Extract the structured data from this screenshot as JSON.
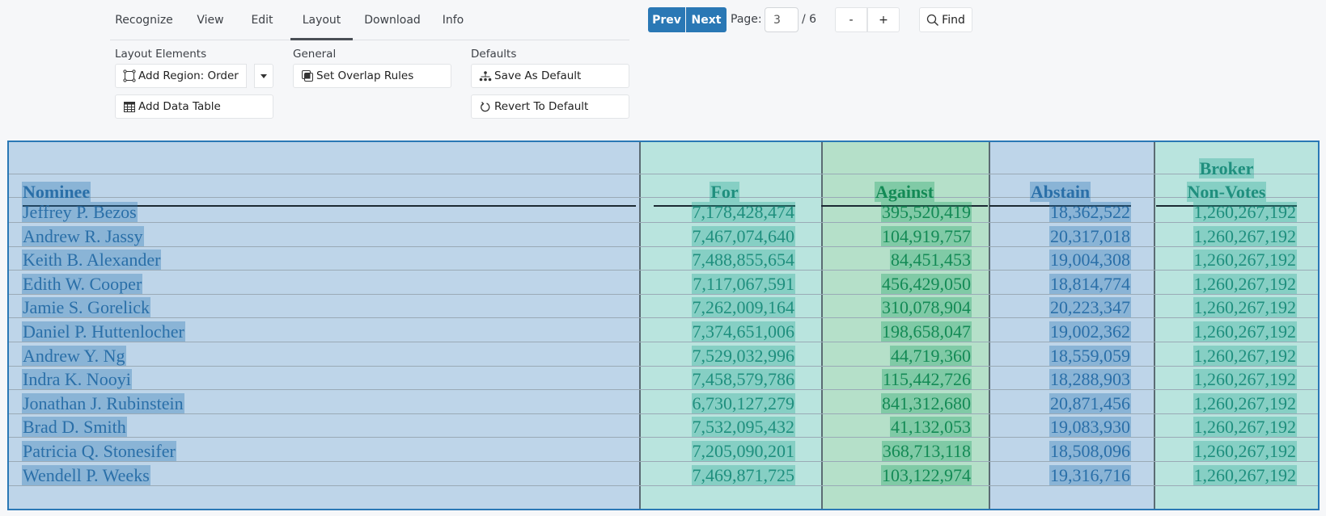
{
  "tabs": [
    {
      "label": "Recognize",
      "active": false
    },
    {
      "label": "View",
      "active": false
    },
    {
      "label": "Edit",
      "active": false
    },
    {
      "label": "Layout",
      "active": true
    },
    {
      "label": "Download",
      "active": false
    },
    {
      "label": "Info",
      "active": false
    }
  ],
  "groups": {
    "layout_elements": {
      "label": "Layout Elements",
      "add_region": "Add Region: Order",
      "add_data_table": "Add Data Table"
    },
    "general": {
      "label": "General",
      "set_overlap_rules": "Set Overlap Rules"
    },
    "defaults": {
      "label": "Defaults",
      "save_as_default": "Save As Default",
      "revert_to_default": "Revert To Default"
    }
  },
  "pager": {
    "prev": "Prev",
    "next": "Next",
    "page_label": "Page:",
    "page_value": "3",
    "total": "/ 6",
    "zoom_out": "-",
    "zoom_in": "+",
    "find": "Find"
  },
  "colors": {
    "accent": "#2a78b5",
    "region_blue": "#bed5e9",
    "region_teal": "#b9e4de",
    "region_green": "#b5e0c9"
  },
  "table": {
    "headers": {
      "nominee": "Nominee",
      "for": "For",
      "against": "Against",
      "abstain": "Abstain",
      "broker_line1": "Broker",
      "broker_line2": "Non-Votes"
    },
    "rows": [
      {
        "nominee": "Jeffrey P. Bezos",
        "for": "7,178,428,474",
        "against": "395,520,419",
        "abstain": "18,362,522",
        "broker": "1,260,267,192"
      },
      {
        "nominee": "Andrew R. Jassy",
        "for": "7,467,074,640",
        "against": "104,919,757",
        "abstain": "20,317,018",
        "broker": "1,260,267,192"
      },
      {
        "nominee": "Keith B. Alexander",
        "for": "7,488,855,654",
        "against": "84,451,453",
        "abstain": "19,004,308",
        "broker": "1,260,267,192"
      },
      {
        "nominee": "Edith W. Cooper",
        "for": "7,117,067,591",
        "against": "456,429,050",
        "abstain": "18,814,774",
        "broker": "1,260,267,192"
      },
      {
        "nominee": "Jamie S. Gorelick",
        "for": "7,262,009,164",
        "against": "310,078,904",
        "abstain": "20,223,347",
        "broker": "1,260,267,192"
      },
      {
        "nominee": "Daniel P. Huttenlocher",
        "for": "7,374,651,006",
        "against": "198,658,047",
        "abstain": "19,002,362",
        "broker": "1,260,267,192"
      },
      {
        "nominee": "Andrew Y. Ng",
        "for": "7,529,032,996",
        "against": "44,719,360",
        "abstain": "18,559,059",
        "broker": "1,260,267,192"
      },
      {
        "nominee": "Indra K. Nooyi",
        "for": "7,458,579,786",
        "against": "115,442,726",
        "abstain": "18,288,903",
        "broker": "1,260,267,192"
      },
      {
        "nominee": "Jonathan J. Rubinstein",
        "for": "6,730,127,279",
        "against": "841,312,680",
        "abstain": "20,871,456",
        "broker": "1,260,267,192"
      },
      {
        "nominee": "Brad D. Smith",
        "for": "7,532,095,432",
        "against": "41,132,053",
        "abstain": "19,083,930",
        "broker": "1,260,267,192"
      },
      {
        "nominee": "Patricia Q. Stonesifer",
        "for": "7,205,090,201",
        "against": "368,713,118",
        "abstain": "18,508,096",
        "broker": "1,260,267,192"
      },
      {
        "nominee": "Wendell P. Weeks",
        "for": "7,469,871,725",
        "against": "103,122,974",
        "abstain": "19,316,716",
        "broker": "1,260,267,192"
      }
    ]
  }
}
